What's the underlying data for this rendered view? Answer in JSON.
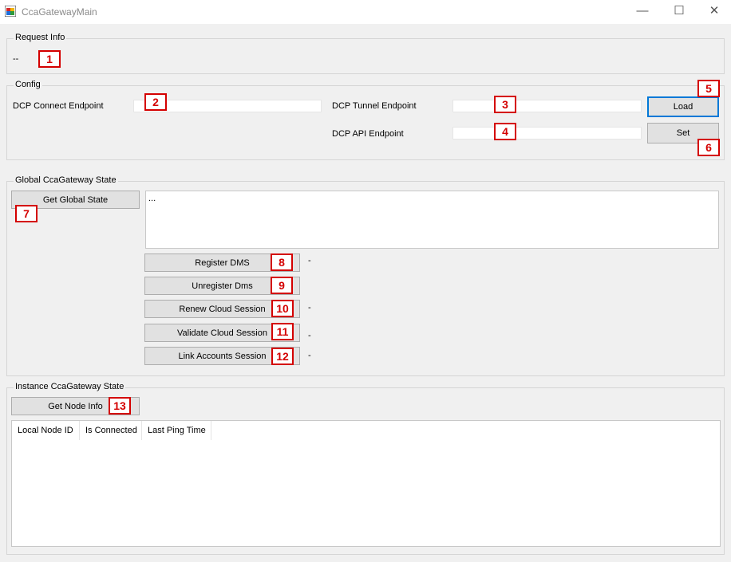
{
  "window": {
    "title": "CcaGatewayMain"
  },
  "request_info": {
    "legend": "Request Info",
    "value": "--"
  },
  "config": {
    "legend": "Config",
    "connect_label": "DCP Connect Endpoint",
    "connect_value": "",
    "tunnel_label": "DCP Tunnel Endpoint",
    "tunnel_value": "",
    "api_label": "DCP API Endpoint",
    "api_value": "",
    "load_label": "Load",
    "set_label": "Set"
  },
  "global_state": {
    "legend": "Global CcaGateway State",
    "get_label": "Get Global State",
    "output": "...",
    "actions": [
      {
        "label": "Register DMS",
        "result": "-"
      },
      {
        "label": "Unregister Dms",
        "result": ""
      },
      {
        "label": "Renew Cloud Session",
        "result": "-"
      },
      {
        "label": "Validate Cloud Session",
        "result": "-"
      },
      {
        "label": "Link Accounts Session",
        "result": "-"
      }
    ]
  },
  "instance_state": {
    "legend": "Instance CcaGateway State",
    "get_label": "Get Node Info",
    "columns": [
      "Local Node ID",
      "Is Connected",
      "Last Ping Time"
    ]
  },
  "annotations": [
    "1",
    "2",
    "3",
    "4",
    "5",
    "6",
    "7",
    "8",
    "9",
    "10",
    "11",
    "12",
    "13"
  ],
  "colors": {
    "annotation": "#d40000",
    "focus_border": "#0078d7"
  }
}
